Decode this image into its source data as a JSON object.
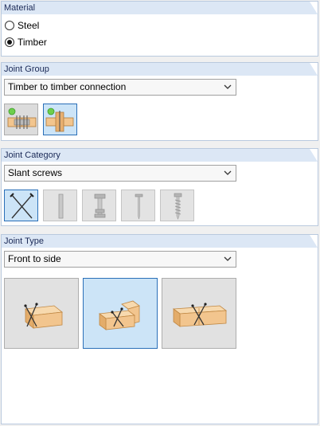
{
  "material": {
    "title": "Material",
    "options": [
      {
        "label": "Steel",
        "checked": false
      },
      {
        "label": "Timber",
        "checked": true
      }
    ]
  },
  "joint_group": {
    "title": "Joint Group",
    "selected": "Timber to timber connection",
    "buttons": [
      {
        "icon": "timber-splice-plate-icon",
        "selected": false
      },
      {
        "icon": "timber-cross-connection-icon",
        "selected": true
      }
    ]
  },
  "joint_category": {
    "title": "Joint Category",
    "selected": "Slant screws",
    "buttons": [
      {
        "icon": "slant-screws-icon",
        "selected": true
      },
      {
        "icon": "dowel-icon",
        "selected": false
      },
      {
        "icon": "bolt-icon",
        "selected": false
      },
      {
        "icon": "nail-icon",
        "selected": false
      },
      {
        "icon": "screw-icon",
        "selected": false
      }
    ]
  },
  "joint_type": {
    "title": "Joint Type",
    "selected": "Front to side",
    "options": [
      {
        "icon": "beam-end-screws-icon",
        "selected": false
      },
      {
        "icon": "front-to-side-screws-icon",
        "selected": true
      },
      {
        "icon": "side-screws-icon",
        "selected": false
      }
    ]
  },
  "colors": {
    "header_bg": "#dce7f5",
    "header_text": "#1b2a57",
    "selection_border": "#2a6fb8",
    "selection_bg": "#cce4f7",
    "timber": "#f2c58e"
  }
}
